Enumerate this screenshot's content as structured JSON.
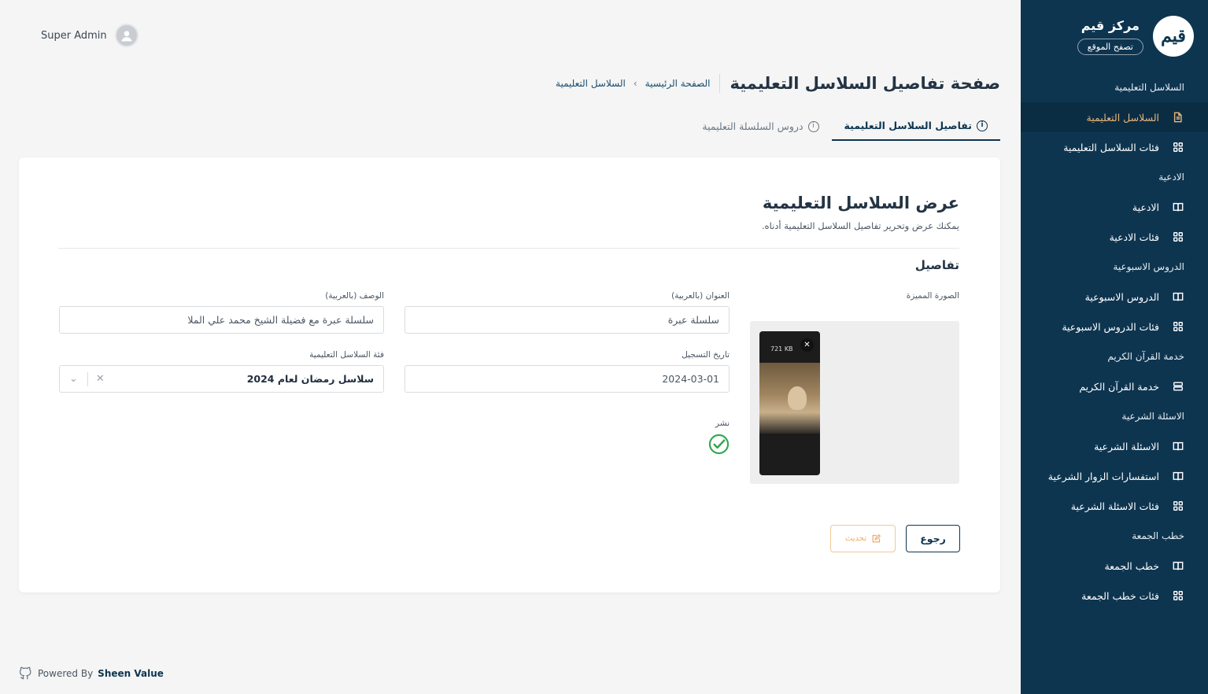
{
  "user": {
    "name": "Super Admin"
  },
  "brand": {
    "name": "مركز قيم",
    "logo_text": "قيم",
    "browse_label": "تصفح الموقع"
  },
  "sidebar": {
    "groups": [
      {
        "title": "السلاسل التعليمية",
        "items": [
          {
            "label": "السلاسل التعليمية",
            "icon": "document-icon",
            "active": true
          },
          {
            "label": "فئات السلاسل التعليمية",
            "icon": "grid-icon"
          }
        ]
      },
      {
        "title": "الادعية",
        "items": [
          {
            "label": "الادعية",
            "icon": "book-icon"
          },
          {
            "label": "فئات الادعية",
            "icon": "grid-icon"
          }
        ]
      },
      {
        "title": "الدروس الاسبوعية",
        "items": [
          {
            "label": "الدروس الاسبوعية",
            "icon": "book-icon"
          },
          {
            "label": "فئات الدروس الاسبوعية",
            "icon": "grid-icon"
          }
        ]
      },
      {
        "title": "خدمة القرآن الكريم",
        "items": [
          {
            "label": "خدمة القرآن الكريم",
            "icon": "server-icon"
          }
        ]
      },
      {
        "title": "الاسئلة الشرعية",
        "items": [
          {
            "label": "الاسئلة الشرعية",
            "icon": "book-icon"
          },
          {
            "label": "استفسارات الزوار الشرعية",
            "icon": "book-icon"
          },
          {
            "label": "فئات الاسئلة الشرعية",
            "icon": "grid-icon"
          }
        ]
      },
      {
        "title": "خطب الجمعة",
        "items": [
          {
            "label": "خطب الجمعة",
            "icon": "book-icon"
          },
          {
            "label": "فئات خطب الجمعة",
            "icon": "grid-icon"
          }
        ]
      }
    ]
  },
  "header": {
    "title": "صفحة تفاصيل السلاسل التعليمية",
    "breadcrumb": {
      "home": "الصفحة الرئيسية",
      "separator": "›",
      "current": "السلاسل التعليمية"
    }
  },
  "tabs": [
    {
      "label": "تفاصيل السلاسل التعليمية",
      "active": true
    },
    {
      "label": "دروس السلسلة التعليمية",
      "active": false
    }
  ],
  "card": {
    "title": "عرض السلاسل التعليمية",
    "subtitle": "يمكنك عرض وتحرير تفاصيل السلاسل التعليمية أدناه.",
    "section_title": "تفاصيل"
  },
  "form": {
    "featured_image_label": "الصورة المميزة",
    "image_size": "721 KB",
    "title_label": "العنوان (بالعربية)",
    "title_value": "سلسلة عبرة",
    "description_label": "الوصف (بالعربية)",
    "description_value": "سلسلة عبرة مع فضيلة الشيخ محمد علي الملا",
    "date_label": "تاريخ التسجيل",
    "date_value": "2024-03-01",
    "category_label": "فئة السلاسل التعليمية",
    "category_value": "سلاسل رمضان لعام 2024",
    "publish_label": "نشر",
    "published": true
  },
  "buttons": {
    "back": "رجوع",
    "update": "تحديث"
  },
  "footer": {
    "prefix": "Powered By",
    "company": "Sheen Value"
  },
  "colors": {
    "sidebar": "#0e3550",
    "accent": "#e9b77a",
    "success": "#2fa84f"
  }
}
